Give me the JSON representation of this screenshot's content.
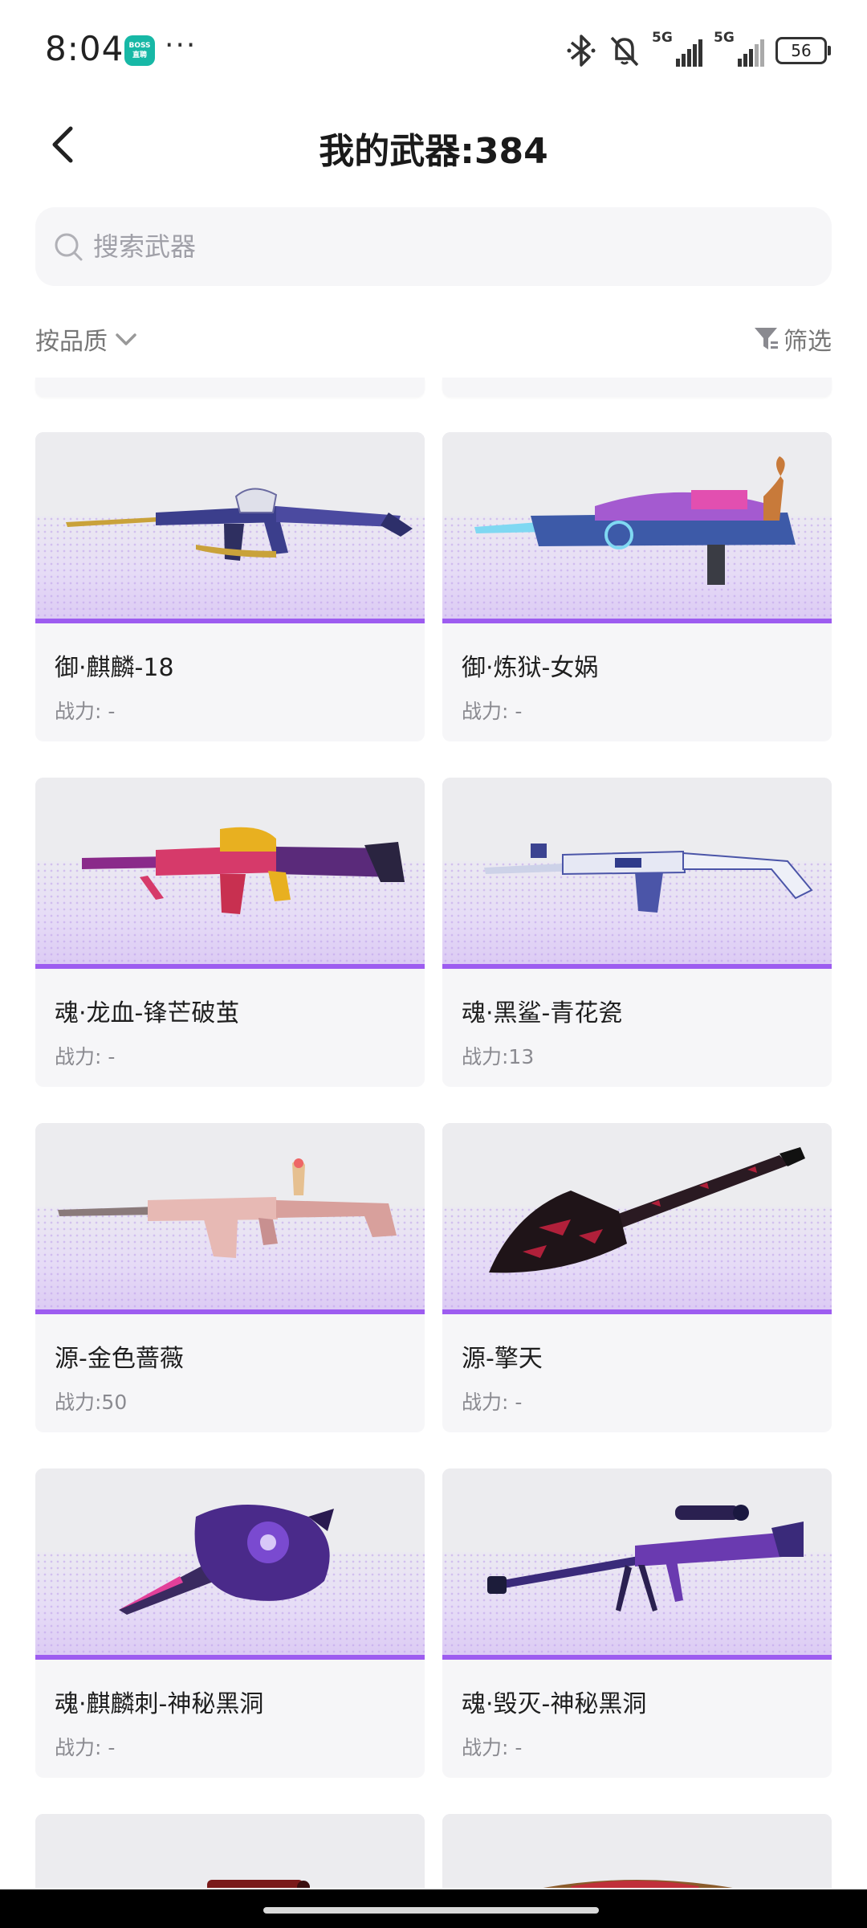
{
  "status_bar": {
    "time": "8:04",
    "app_badge": "BOSS 直聘",
    "more": "···",
    "signal1_label": "5G",
    "signal2_label": "5G",
    "battery": "56",
    "icons": [
      "bluetooth-icon",
      "mute-icon",
      "signal-icon",
      "signal-icon",
      "battery-icon"
    ]
  },
  "header": {
    "title": "我的武器:384",
    "back_icon": "chevron-left-icon"
  },
  "search": {
    "placeholder": "搜索武器",
    "value": ""
  },
  "filters": {
    "sort_label": "按品质",
    "filter_label": "筛选"
  },
  "theme": {
    "accent": "#9d5cf0",
    "card_bg": "#f6f6f8",
    "muted_text": "#8a8a90"
  },
  "weapons": [
    {
      "name": "御·麒麟-18",
      "power": "战力: -"
    },
    {
      "name": "御·炼狱-女娲",
      "power": "战力: -"
    },
    {
      "name": "魂·龙血-锋芒破茧",
      "power": "战力: -"
    },
    {
      "name": "魂·黑鲨-青花瓷",
      "power": "战力:13"
    },
    {
      "name": "源-金色蔷薇",
      "power": "战力:50"
    },
    {
      "name": "源-擎天",
      "power": "战力: -"
    },
    {
      "name": "魂·麒麟刺-神秘黑洞",
      "power": "战力: -"
    },
    {
      "name": "魂·毁灭-神秘黑洞",
      "power": "战力: -"
    }
  ]
}
